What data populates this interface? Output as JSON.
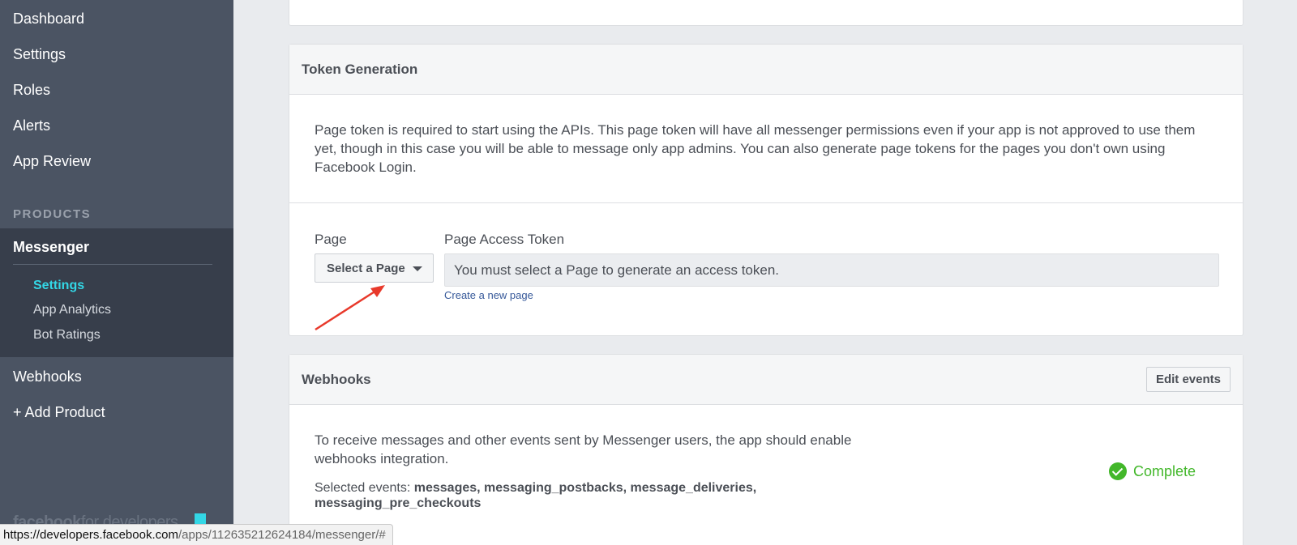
{
  "sidebar": {
    "items": [
      "Dashboard",
      "Settings",
      "Roles",
      "Alerts",
      "App Review"
    ],
    "products_label": "PRODUCTS",
    "product": {
      "title": "Messenger",
      "sub_items": [
        "Settings",
        "App Analytics",
        "Bot Ratings"
      ]
    },
    "after_items": [
      "Webhooks",
      "+ Add Product"
    ],
    "logo_bold": "facebook",
    "logo_light": "for developers",
    "accent_color": "#33d7e6"
  },
  "token_generation": {
    "title": "Token Generation",
    "description": "Page token is required to start using the APIs. This page token will have all messenger permissions even if your app is not approved to use them yet, though in this case you will be able to message only app admins. You can also generate page tokens for the pages you don't own using Facebook Login.",
    "page_label": "Page",
    "select_button": "Select a Page",
    "token_label": "Page Access Token",
    "token_placeholder": "You must select a Page to generate an access token.",
    "create_link": "Create a new page"
  },
  "webhooks": {
    "title": "Webhooks",
    "edit_button": "Edit events",
    "description": "To receive messages and other events sent by Messenger users, the app should enable webhooks integration.",
    "selected_prefix": "Selected events: ",
    "selected_events": "messages, messaging_postbacks, message_deliveries, messaging_pre_checkouts",
    "status": "Complete",
    "status_color": "#42b72a"
  },
  "statusbar": {
    "host": "https://developers.facebook.com",
    "path": "/apps/112635212624184/messenger/#"
  }
}
